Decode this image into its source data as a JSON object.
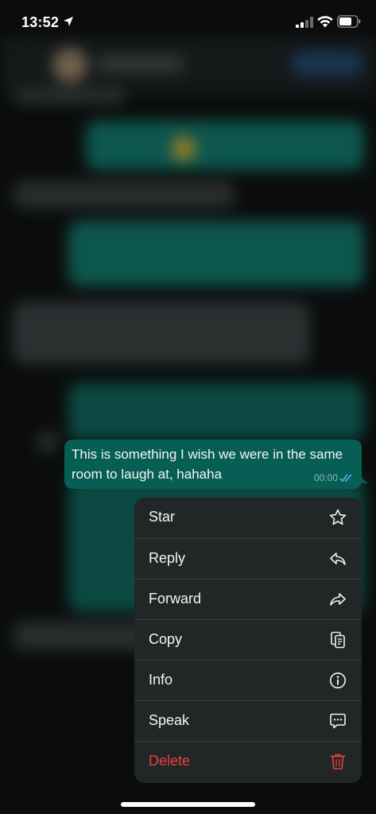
{
  "status_bar": {
    "time": "13:52"
  },
  "message": {
    "text": "This is something I wish we were in the same room to laugh at, hahaha",
    "time": "00:00",
    "read_color": "#4fb8f0",
    "bubble_color": "#075e54"
  },
  "menu": {
    "items": [
      {
        "label": "Star",
        "icon": "star-icon"
      },
      {
        "label": "Reply",
        "icon": "reply-icon"
      },
      {
        "label": "Forward",
        "icon": "forward-icon"
      },
      {
        "label": "Copy",
        "icon": "copy-icon"
      },
      {
        "label": "Info",
        "icon": "info-icon"
      },
      {
        "label": "Speak",
        "icon": "speech-bubble-icon"
      },
      {
        "label": "Delete",
        "icon": "trash-icon",
        "color": "#e5413a"
      }
    ]
  }
}
